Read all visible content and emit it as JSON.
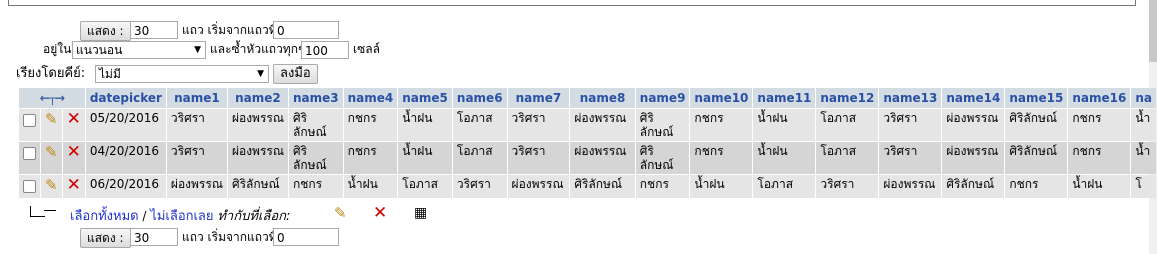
{
  "nav_top": {
    "show_label": "แสดง :",
    "rows_value": "30",
    "rows_suffix": "แถว เริ่มจากแถวที่",
    "start_value": "0",
    "mode_prefix": "อยู่ใน",
    "mode_value": "แนวนอน",
    "repeat_label": "และซ้ำหัวแถวทุกๆ",
    "repeat_value": "100",
    "cells_label": "เซลล์"
  },
  "sort": {
    "label": "เรียงโดยคีย์:",
    "value": "ไม่มี",
    "go_label": "ลงมือ"
  },
  "table": {
    "columns": [
      "datepicker",
      "name1",
      "name2",
      "name3",
      "name4",
      "name5",
      "name6",
      "name7",
      "name8",
      "name9",
      "name10",
      "name11",
      "name12",
      "name13",
      "name14",
      "name15",
      "name16",
      "na"
    ],
    "rows": [
      [
        "05/20/2016",
        "วริศรา",
        "ผ่องพรรณ",
        "ศิริ ลักษณ์",
        "กชกร",
        "น้ำฝน",
        "โอภาส",
        "วริศรา",
        "ผ่องพรรณ",
        "ศิริ ลักษณ์",
        "กชกร",
        "น้ำฝน",
        "โอภาส",
        "วริศรา",
        "ผ่องพรรณ",
        "ศิริลักษณ์",
        "กชกร",
        "น้ำ"
      ],
      [
        "04/20/2016",
        "วริศรา",
        "ผ่องพรรณ",
        "ศิริ ลักษณ์",
        "กชกร",
        "น้ำฝน",
        "โอภาส",
        "วริศรา",
        "ผ่องพรรณ",
        "ศิริ ลักษณ์",
        "กชกร",
        "น้ำฝน",
        "โอภาส",
        "วริศรา",
        "ผ่องพรรณ",
        "ศิริลักษณ์",
        "กชกร",
        "น้ำ"
      ],
      [
        "06/20/2016",
        "ผ่องพรรณ",
        "ศิริลักษณ์",
        "กชกร",
        "น้ำฝน",
        "โอภาส",
        "วริศรา",
        "ผ่องพรรณ",
        "ศิริลักษณ์",
        "กชกร",
        "น้ำฝน",
        "โอภาส",
        "วริศรา",
        "ผ่องพรรณ",
        "ศิริลักษณ์",
        "กชกร",
        "น้ำฝน",
        "โ"
      ]
    ]
  },
  "bulk": {
    "select_all": "เลือกทั้งหมด",
    "separator": "/",
    "unselect_all": "ไม่เลือกเลย",
    "with_selected": "ทำกับที่เลือก:"
  },
  "nav_bottom": {
    "show_label": "แสดง :",
    "rows_value": "30",
    "rows_suffix": "แถว เริ่มจากแถวที่",
    "start_value": "0"
  }
}
